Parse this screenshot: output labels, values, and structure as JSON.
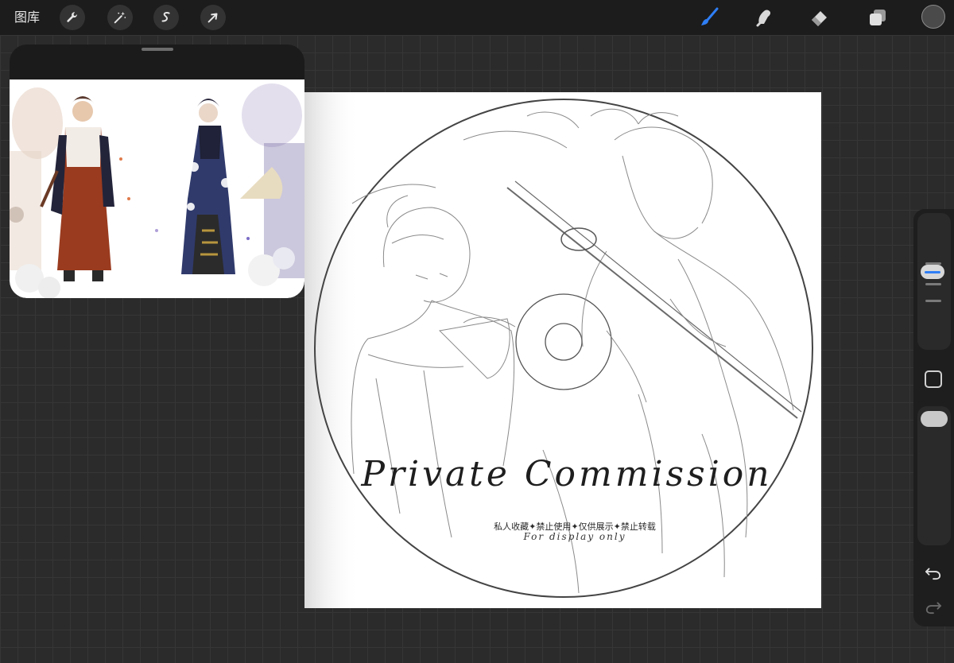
{
  "topbar": {
    "gallery_label": "图库",
    "left_tools": [
      {
        "name": "wrench-icon",
        "label": "Actions"
      },
      {
        "name": "magic-wand-icon",
        "label": "Adjustments"
      },
      {
        "name": "selection-s-icon",
        "label": "Selection"
      },
      {
        "name": "arrow-cursor-icon",
        "label": "Transform"
      }
    ],
    "right_tools": [
      {
        "name": "brush-icon",
        "active": true,
        "color": "#2f7ef5"
      },
      {
        "name": "smudge-icon",
        "active": false
      },
      {
        "name": "eraser-icon",
        "active": false
      },
      {
        "name": "layers-icon",
        "active": false
      }
    ],
    "current_color": "#4a4a4a"
  },
  "reference_window": {
    "visible": true
  },
  "canvas": {
    "title": "Private Commission",
    "notice": "私人收藏✦禁止使用✦仅供展示✦禁止转载",
    "subtitle": "For display only"
  },
  "sidebar": {
    "brush_size_icon": "brush-size-slider",
    "modify_icon": "square-modify-icon",
    "opacity_icon": "opacity-slider",
    "undo_icon": "undo-icon",
    "redo_icon": "redo-icon"
  },
  "colors": {
    "toolbar_bg": "#1c1c1c",
    "workspace_bg": "#2b2b2b",
    "accent": "#2f7ef5"
  }
}
